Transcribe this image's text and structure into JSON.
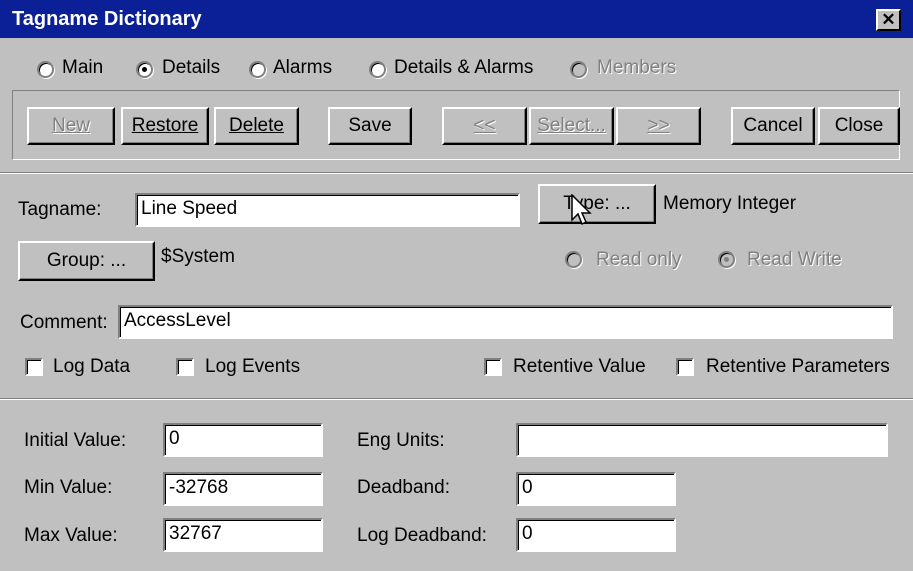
{
  "window": {
    "title": "Tagname Dictionary",
    "close_glyph": "✕"
  },
  "view_options": [
    {
      "label": "Main",
      "selected": false,
      "enabled": true
    },
    {
      "label": "Details",
      "selected": true,
      "enabled": true
    },
    {
      "label": "Alarms",
      "selected": false,
      "enabled": true
    },
    {
      "label": "Details & Alarms",
      "selected": false,
      "enabled": true
    },
    {
      "label": "Members",
      "selected": false,
      "enabled": false
    }
  ],
  "toolbar": {
    "new": "New",
    "restore": "Restore",
    "delete": "Delete",
    "save": "Save",
    "prev": "<<",
    "select": "Select...",
    "next": ">>",
    "cancel": "Cancel",
    "close": "Close"
  },
  "tag": {
    "tagname_label": "Tagname:",
    "tagname_value": "Line Speed",
    "type_button": "Type: ...",
    "type_value": "Memory Integer",
    "group_button": "Group: ...",
    "group_value": "$System",
    "read_only_label": "Read only",
    "read_write_label": "Read Write",
    "access": "Read Write",
    "comment_label": "Comment:",
    "comment_value": "AccessLevel"
  },
  "checks": {
    "log_data": {
      "label": "Log Data",
      "checked": false
    },
    "log_events": {
      "label": "Log Events",
      "checked": false
    },
    "retentive_value": {
      "label": "Retentive Value",
      "checked": false
    },
    "retentive_parameters": {
      "label": "Retentive Parameters",
      "checked": false
    }
  },
  "details": {
    "initial_value_label": "Initial Value:",
    "initial_value": "0",
    "min_value_label": "Min Value:",
    "min_value": "-32768",
    "max_value_label": "Max Value:",
    "max_value": "32767",
    "eng_units_label": "Eng Units:",
    "eng_units": "",
    "deadband_label": "Deadband:",
    "deadband": "0",
    "log_deadband_label": "Log Deadband:",
    "log_deadband": "0"
  },
  "icons": {
    "cursor": "mouse-pointer-icon"
  }
}
